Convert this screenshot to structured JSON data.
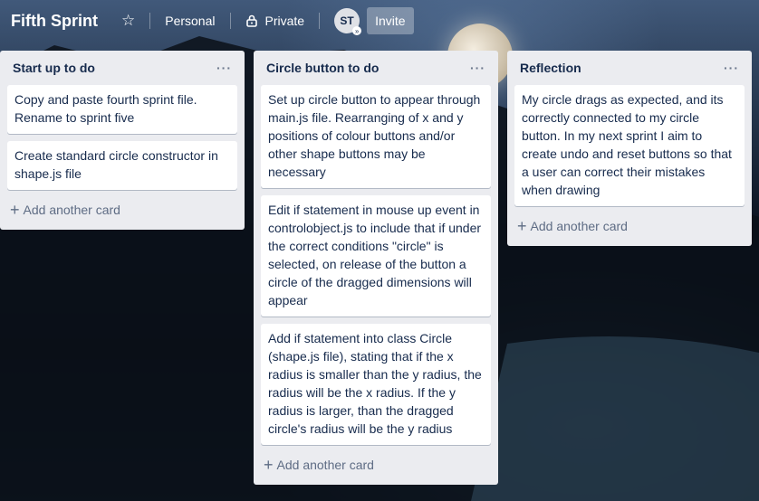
{
  "header": {
    "board_title": "Fifth Sprint",
    "star_icon": "star-icon",
    "workspace_label": "Personal",
    "visibility_label": "Private",
    "avatar_initials": "ST",
    "invite_label": "Invite"
  },
  "lists": [
    {
      "title": "Start up to do",
      "menu": "···",
      "cards": [
        "Copy and paste fourth sprint file. Rename to sprint five",
        "Create standard circle constructor in shape.js file"
      ],
      "add_card": "Add another card"
    },
    {
      "title": "Circle button to do",
      "menu": "···",
      "cards": [
        "Set up circle button to appear through main.js file. Rearranging of x and y positions of colour buttons and/or other shape buttons may be necessary",
        "Edit if statement in mouse up event in controlobject.js to include that if under the correct conditions \"circle\" is selected, on release of the button a circle of the dragged dimensions will appear",
        "Add if statement into class Circle (shape.js file), stating that if the x radius is smaller than the y radius, the radius will be the x radius. If the y radius is larger, than the dragged circle's radius will be the y radius"
      ],
      "add_card": "Add another card"
    },
    {
      "title": "Reflection",
      "menu": "···",
      "cards": [
        "My circle drags as expected, and its correctly connected to my circle button. In my next sprint I aim to create undo and reset buttons so that a user can correct their mistakes when drawing"
      ],
      "add_card": "Add another card"
    }
  ]
}
